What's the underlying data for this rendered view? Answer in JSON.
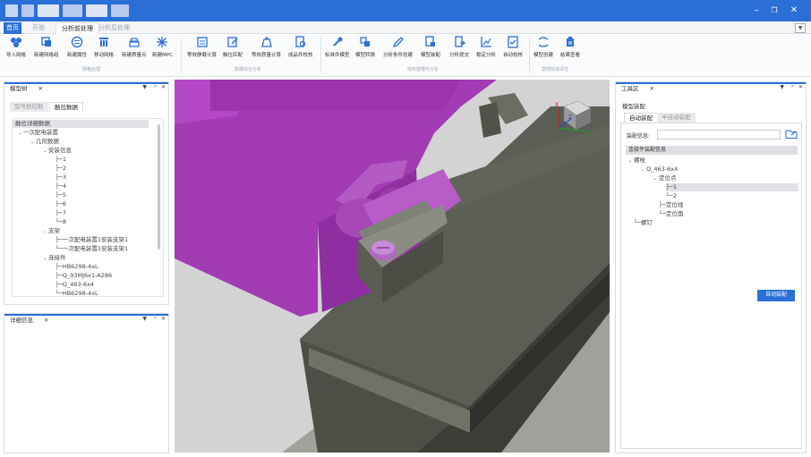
{
  "menu": {
    "tabs": [
      "首页",
      "开始",
      "分析前处理",
      "分析后处理"
    ]
  },
  "ribbon": {
    "buttons": [
      "导入网格",
      "新建网格组",
      "新建属性",
      "移动网格",
      "新建质量点",
      "新建MPC",
      "等效静载计算",
      "触位匹配",
      "等效质量计算",
      "成品件校核",
      "标准件模型",
      "模型转换",
      "分析条件创建",
      "模型装配",
      "分析提交",
      "稳定分析",
      "自动校核",
      "模型创建",
      "结果查看"
    ],
    "groups": [
      "网格处理",
      "数据综合分析",
      "结构建模与分析",
      "案例快速评估"
    ]
  },
  "left_panel": {
    "title": "模型树",
    "subtabs": [
      "型号数控数",
      "触位数据"
    ],
    "tree": [
      "触位详细数据",
      "一次配电装置",
      "几何数据",
      "安装信息",
      "1",
      "2",
      "3",
      "4",
      "5",
      "6",
      "7",
      "8",
      "支架",
      "一次配电装置1安装支架1",
      "一次配电装置1安装支架1",
      "连接件",
      "HB6298-4xL",
      "Q_93MJ6x1-A286",
      "Q_463-6x4",
      "HB6298-4xL"
    ]
  },
  "detail_panel": {
    "title": "详细信息"
  },
  "right_panel": {
    "title": "工具区",
    "section": "模型装配",
    "subtabs": [
      "自动装配",
      "半自动装配"
    ],
    "field_label": "装配信息:",
    "field_value": "",
    "list_header": "连接件装配信息",
    "tree": [
      "螺栓",
      "Q_463-6x4",
      "定位点",
      "1",
      "2",
      "定位线",
      "定位面",
      "螺钉"
    ],
    "action_button": "自动装配"
  },
  "colors": {
    "titlebar": "#2a6fd6",
    "accent": "#2a6fd6",
    "part_purple": "#a23bb4",
    "part_gray": "#54584e"
  },
  "icons": {
    "gizmo": "view-cube-icon",
    "picker": "picker-icon"
  }
}
